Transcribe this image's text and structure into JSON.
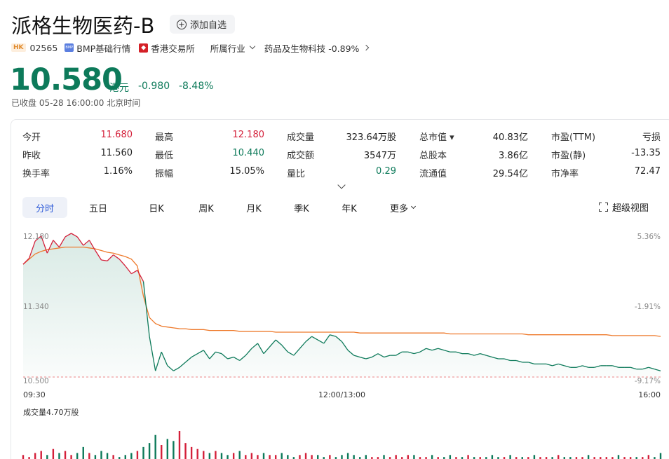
{
  "header": {
    "title": "派格生物医药-B",
    "watch_label": "添加自选",
    "market_tag": "HK",
    "code": "02565",
    "bmp_icon_text": "BMP",
    "bmp_label": "BMP基础行情",
    "exchange_label": "香港交易所",
    "industry_label": "所属行业",
    "sector_label": "药品及生物科技 -0.89%"
  },
  "quote": {
    "price": "10.580",
    "unit": "港元",
    "change": "-0.980",
    "change_pct": "-8.48%",
    "status": "已收盘  05-28 16:00:00  北京时间"
  },
  "stats": [
    {
      "label": "今开",
      "value": "11.680",
      "color": "red"
    },
    {
      "label": "最高",
      "value": "12.180",
      "color": "red"
    },
    {
      "label": "成交量",
      "value": "323.64万股",
      "color": ""
    },
    {
      "label": "总市值 ▾",
      "value": "40.83亿",
      "color": ""
    },
    {
      "label": "市盈(TTM)",
      "value": "亏损",
      "color": ""
    },
    {
      "label": "昨收",
      "value": "11.560",
      "color": ""
    },
    {
      "label": "最低",
      "value": "10.440",
      "color": "green"
    },
    {
      "label": "成交额",
      "value": "3547万",
      "color": ""
    },
    {
      "label": "总股本",
      "value": "3.86亿",
      "color": ""
    },
    {
      "label": "市盈(静)",
      "value": "-13.35",
      "color": ""
    },
    {
      "label": "换手率",
      "value": "1.16%",
      "color": ""
    },
    {
      "label": "振幅",
      "value": "15.05%",
      "color": ""
    },
    {
      "label": "量比",
      "value": "0.29",
      "color": "green"
    },
    {
      "label": "流通值",
      "value": "29.54亿",
      "color": ""
    },
    {
      "label": "市净率",
      "value": "72.47",
      "color": ""
    }
  ],
  "tabs": [
    {
      "label": "分时",
      "active": true
    },
    {
      "label": "五日"
    },
    {
      "label": "日K"
    },
    {
      "label": "周K"
    },
    {
      "label": "月K"
    },
    {
      "label": "季K"
    },
    {
      "label": "年K"
    },
    {
      "label": "更多"
    }
  ],
  "super_view_label": "超级视图",
  "volume_label": "成交量4.70万股",
  "colors": {
    "up": "#d4203a",
    "down": "#0d7a5a",
    "avg_line": "#ee7a2c",
    "accent": "#2e5bd8"
  },
  "chart_data": {
    "type": "line",
    "y_left_ticks": [
      "12.180",
      "11.340",
      "10.500"
    ],
    "y_right_ticks": [
      "5.36%",
      "-1.91%",
      "-9.17%"
    ],
    "x_ticks": [
      "09:30",
      "12:00/13:00",
      "16:00"
    ],
    "ylim": [
      10.5,
      12.18
    ],
    "prev_close": 11.56,
    "series": [
      {
        "values": [
          11.82,
          11.89,
          12.09,
          12.15,
          11.95,
          12.1,
          12.02,
          12.14,
          12.18,
          12.14,
          12.04,
          12.1,
          11.98,
          11.87,
          11.86,
          11.93,
          11.88,
          11.8,
          11.71,
          11.75,
          11.62,
          10.98,
          10.58,
          10.8,
          10.64,
          10.58,
          10.62,
          10.68,
          10.74,
          10.78,
          10.82,
          10.72,
          10.8,
          10.78,
          10.72,
          10.74,
          10.7,
          10.76,
          10.84,
          10.9,
          10.78,
          10.86,
          10.94,
          10.88,
          10.8,
          10.76,
          10.84,
          10.92,
          10.98,
          10.94,
          10.9,
          11.0,
          10.98,
          10.92,
          10.82,
          10.76,
          10.74,
          10.72,
          10.74,
          10.78,
          10.74,
          10.76,
          10.76,
          10.8,
          10.8,
          10.78,
          10.8,
          10.84,
          10.82,
          10.84,
          10.82,
          10.8,
          10.8,
          10.78,
          10.78,
          10.76,
          10.78,
          10.76,
          10.74,
          10.72,
          10.72,
          10.7,
          10.7,
          10.68,
          10.68,
          10.66,
          10.66,
          10.66,
          10.64,
          10.66,
          10.64,
          10.62,
          10.62,
          10.64,
          10.62,
          10.62,
          10.64,
          10.64,
          10.64,
          10.62,
          10.62,
          10.62,
          10.6,
          10.6,
          10.62,
          10.6,
          10.58
        ]
      },
      {
        "values": [
          11.82,
          11.88,
          11.94,
          11.97,
          11.99,
          12.0,
          12.01,
          12.02,
          12.02,
          12.02,
          12.02,
          12.01,
          12.0,
          11.98,
          11.96,
          11.95,
          11.93,
          11.91,
          11.88,
          11.8,
          11.45,
          11.2,
          11.13,
          11.1,
          11.09,
          11.08,
          11.07,
          11.07,
          11.06,
          11.06,
          11.06,
          11.05,
          11.05,
          11.05,
          11.05,
          11.05,
          11.04,
          11.04,
          11.04,
          11.04,
          11.04,
          11.04,
          11.03,
          11.03,
          11.03,
          11.03,
          11.03,
          11.03,
          11.03,
          11.03,
          11.03,
          11.03,
          11.03,
          11.03,
          11.03,
          11.03,
          11.02,
          11.02,
          11.02,
          11.02,
          11.02,
          11.02,
          11.02,
          11.02,
          11.02,
          11.02,
          11.02,
          11.02,
          11.02,
          11.02,
          11.02,
          11.01,
          11.01,
          11.01,
          11.01,
          11.01,
          11.01,
          11.01,
          11.01,
          11.01,
          11.01,
          11.01,
          11.01,
          11.01,
          11.0,
          11.0,
          11.0,
          11.0,
          11.0,
          11.0,
          11.0,
          11.0,
          11.0,
          11.0,
          11.0,
          11.0,
          11.0,
          11.0,
          10.99,
          10.99,
          10.99,
          10.99,
          10.99,
          10.99,
          10.99,
          10.99,
          10.98
        ]
      }
    ],
    "volume": [
      2,
      1,
      3,
      4,
      2,
      5,
      3,
      4,
      2,
      3,
      6,
      3,
      2,
      4,
      3,
      2,
      1,
      2,
      3,
      4,
      6,
      8,
      12,
      7,
      10,
      9,
      14,
      8,
      6,
      5,
      4,
      3,
      4,
      3,
      2,
      3,
      4,
      2,
      3,
      2,
      3,
      2,
      2,
      3,
      2,
      1,
      2,
      3,
      2,
      2,
      1,
      2,
      1,
      2,
      3,
      2,
      1,
      2,
      1,
      1,
      2,
      1,
      2,
      1,
      2,
      2,
      1,
      1,
      2,
      1,
      1,
      2,
      1,
      1,
      2,
      1,
      1,
      1,
      2,
      1,
      1,
      2,
      1,
      1,
      1,
      2,
      1,
      1,
      1,
      2,
      1,
      1,
      1,
      1,
      2,
      1,
      1,
      1,
      1,
      2,
      1,
      1,
      1,
      1,
      2,
      1,
      3
    ]
  }
}
